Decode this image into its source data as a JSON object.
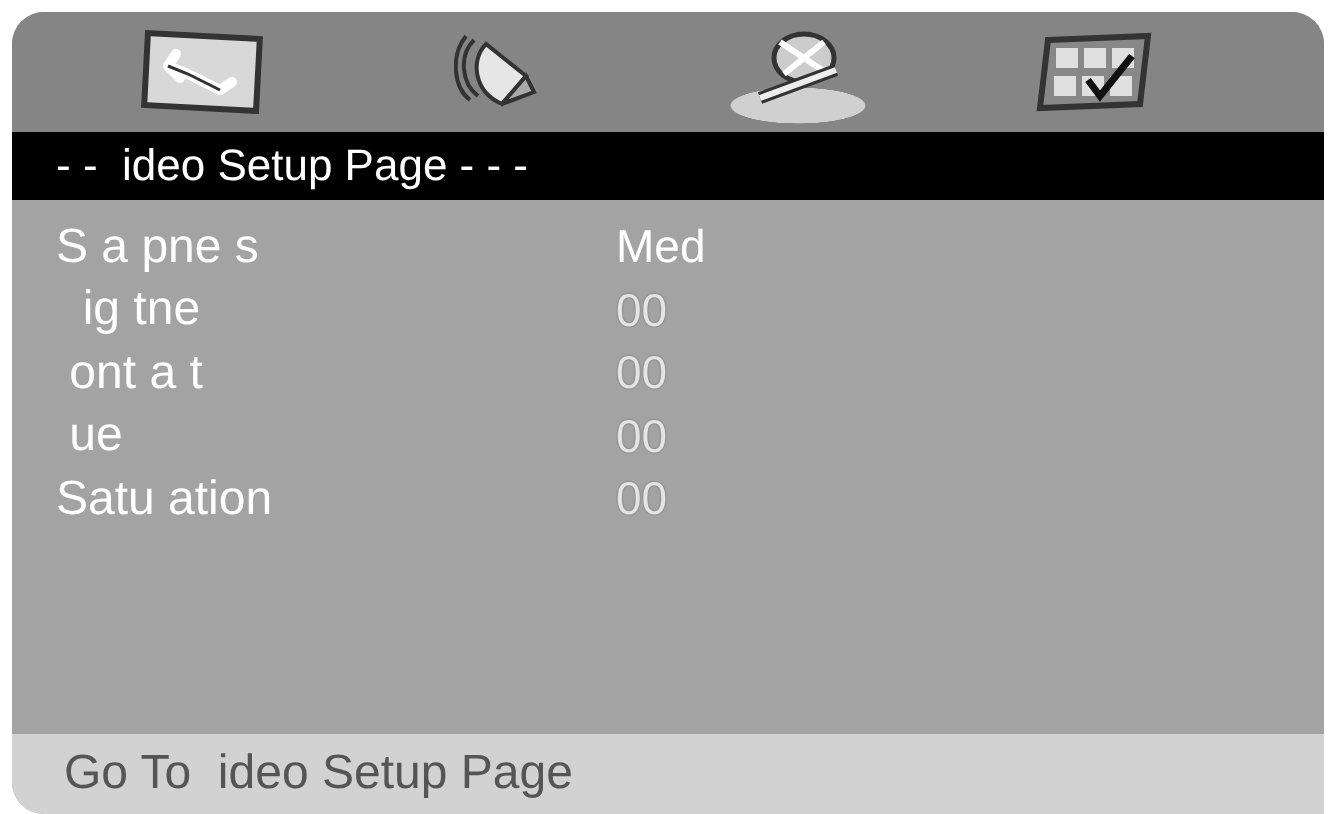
{
  "tabs": [
    {
      "kind": "system",
      "selected": false
    },
    {
      "kind": "audio",
      "selected": false
    },
    {
      "kind": "video",
      "selected": true
    },
    {
      "kind": "preference",
      "selected": false
    }
  ],
  "title": "- -  ideo Setup Page - - -",
  "settings": [
    {
      "label": "S a pne s",
      "value": "Med",
      "faded": false
    },
    {
      "label": "  ig tne",
      "value": "00",
      "faded": true
    },
    {
      "label": " ont a t",
      "value": "00",
      "faded": true
    },
    {
      "label": " ue",
      "value": "00",
      "faded": true
    },
    {
      "label": "Satu ation",
      "value": "00",
      "faded": true
    }
  ],
  "status_bar": "Go To  ideo Setup Page"
}
